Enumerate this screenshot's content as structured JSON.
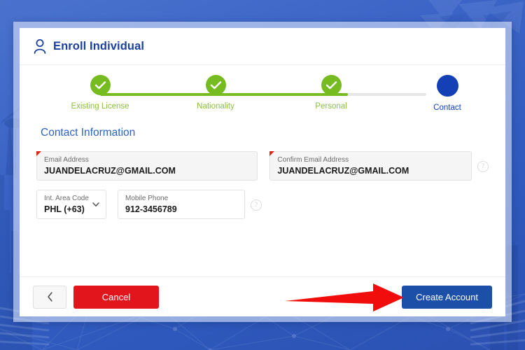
{
  "page": {
    "title": "Enroll Individual",
    "title_icon": "person-icon",
    "accent_blue": "#1b3f9e",
    "accent_green": "#76bc21",
    "accent_red": "#e2151d",
    "background_color": "#3a63c6"
  },
  "stepper": {
    "steps": [
      {
        "label": "Existing License",
        "state": "done",
        "icon": "check-icon"
      },
      {
        "label": "Nationality",
        "state": "done",
        "icon": "check-icon"
      },
      {
        "label": "Personal",
        "state": "done",
        "icon": "check-icon"
      },
      {
        "label": "Contact",
        "state": "current",
        "icon": "filled-circle-icon"
      }
    ],
    "progress_percent": 76
  },
  "form": {
    "section_title": "Contact Information",
    "fields": [
      {
        "name": "email-address",
        "label": "Email Address",
        "value": "JUANDELACRUZ@GMAIL.COM",
        "required": true,
        "style": "filled"
      },
      {
        "name": "confirm-email-address",
        "label": "Confirm Email Address",
        "value": "JUANDELACRUZ@GMAIL.COM",
        "required": true,
        "style": "filled"
      },
      {
        "name": "int-area-code",
        "label": "Int. Area Code",
        "value": "PHL (+63)",
        "required": false,
        "style": "plain",
        "control": "select",
        "icon": "chevron-down-icon"
      },
      {
        "name": "mobile-phone",
        "label": "Mobile Phone",
        "value": "912-3456789",
        "required": false,
        "style": "plain"
      }
    ],
    "help_icon_glyph": "?"
  },
  "footer": {
    "back_label": "‹",
    "back_icon": "chevron-left-icon",
    "cancel_label": "Cancel",
    "submit_label": "Create Account"
  },
  "annotation": {
    "arrow_icon": "arrow-right-annotation",
    "arrow_color": "#f20d0d"
  }
}
